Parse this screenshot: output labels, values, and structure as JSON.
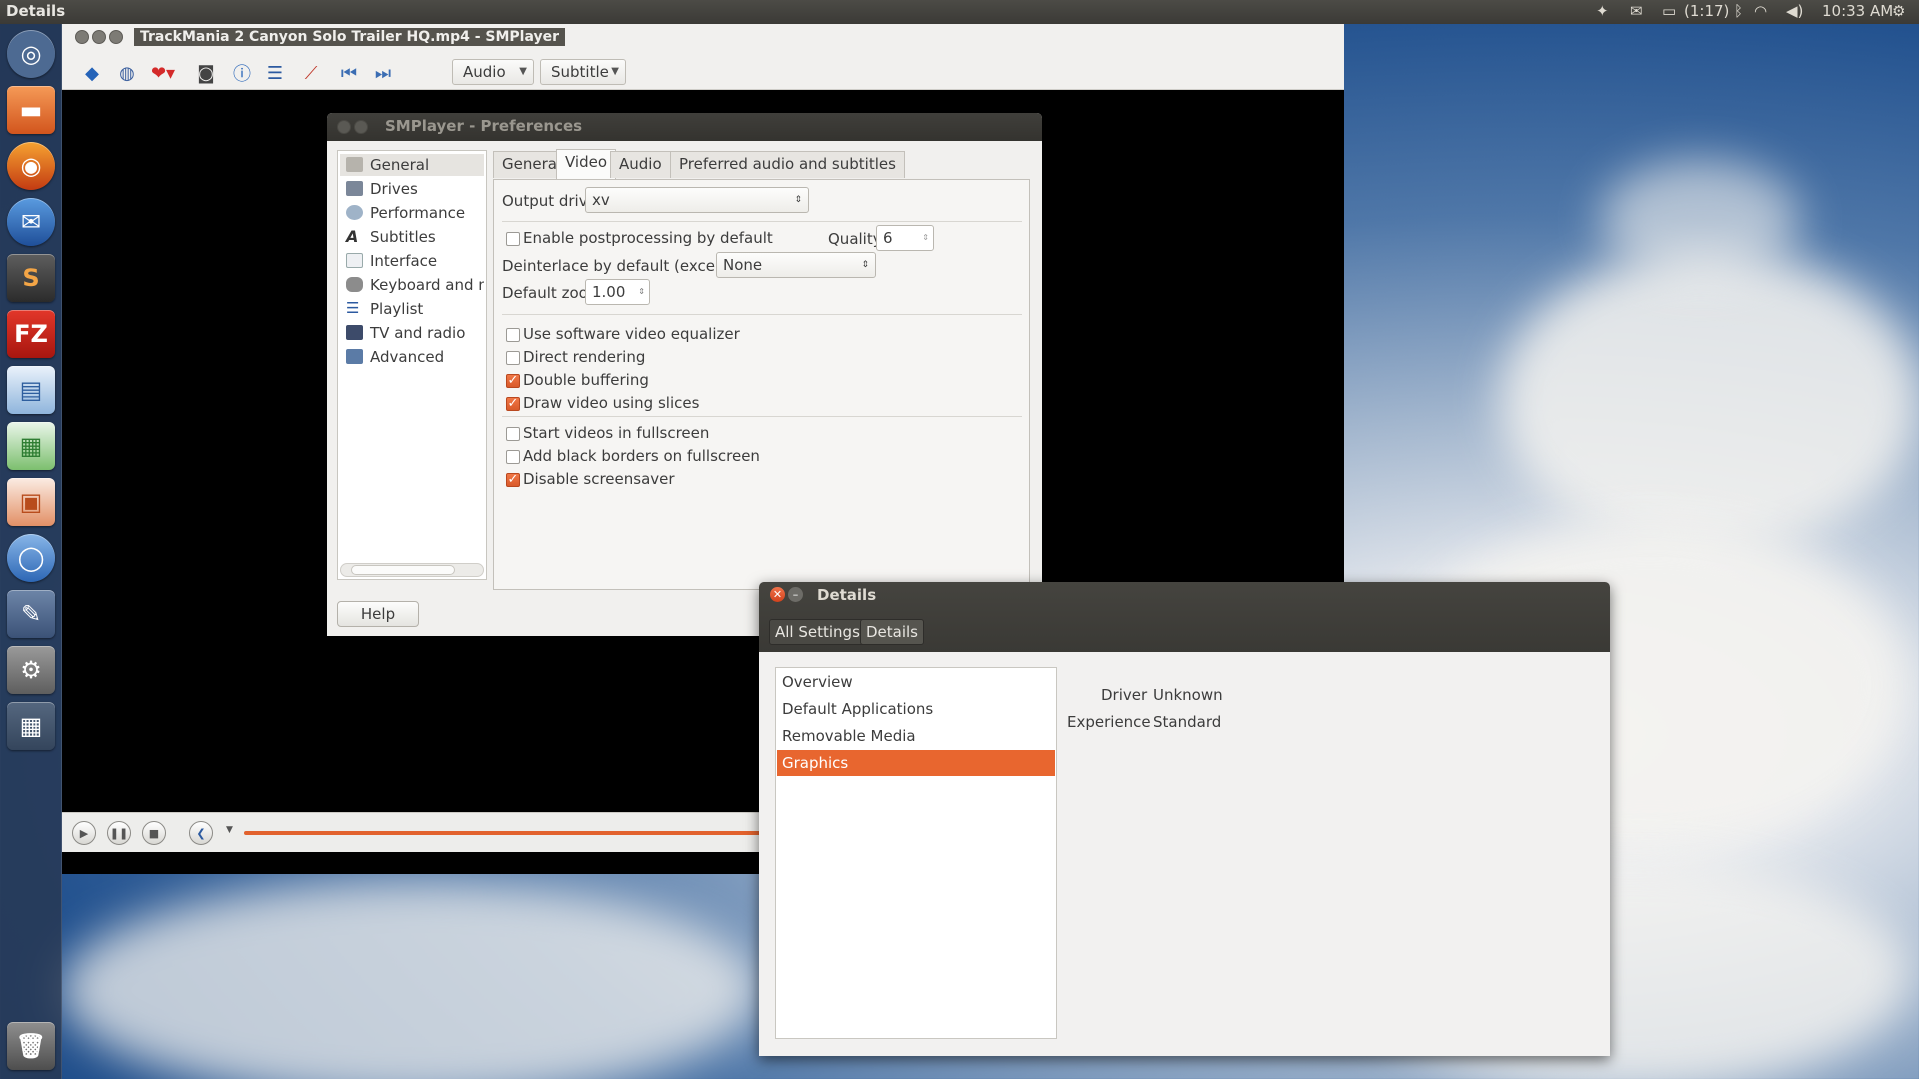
{
  "top_panel": {
    "app_title": "Details",
    "battery": "(1:17)",
    "clock": "10:33 AM"
  },
  "launcher": {
    "items": [
      "Dash home",
      "Files",
      "Firefox",
      "Thunderbird",
      "Sublime Text",
      "FileZilla",
      "Writer",
      "Calc",
      "Impress",
      "Chromium",
      "System Tools",
      "System Settings",
      "Workspace Switcher",
      "Trash"
    ]
  },
  "smplayer": {
    "window_title": "TrackMania 2 Canyon Solo Trailer HQ.mp4 - SMPlayer",
    "toolbar": {
      "audio_label": "Audio",
      "subtitle_label": "Subtitle"
    }
  },
  "prefs": {
    "title": "SMPlayer - Preferences",
    "sections": [
      "General",
      "Drives",
      "Performance",
      "Subtitles",
      "Interface",
      "Keyboard and mo",
      "Playlist",
      "TV and radio",
      "Advanced"
    ],
    "selected_section": "General",
    "tabs": [
      "General",
      "Video",
      "Audio",
      "Preferred audio and subtitles"
    ],
    "active_tab": "Video",
    "output_driver_label": "Output driver:",
    "output_driver_value": "xv",
    "postprocessing_label": "Enable postprocessing by default",
    "postprocessing_checked": false,
    "quality_label": "Quality:",
    "quality_value": "6",
    "deinterlace_label": "Deinterlace by default (except for TV):",
    "deinterlace_value": "None",
    "zoom_label": "Default zoom:",
    "zoom_value": "1.00",
    "options": [
      {
        "label": "Use software video equalizer",
        "checked": false
      },
      {
        "label": "Direct rendering",
        "checked": false
      },
      {
        "label": "Double buffering",
        "checked": true
      },
      {
        "label": "Draw video using slices",
        "checked": true
      },
      {
        "label": "Start videos in fullscreen",
        "checked": false
      },
      {
        "label": "Add black borders on fullscreen",
        "checked": false
      },
      {
        "label": "Disable screensaver",
        "checked": true
      }
    ],
    "help_label": "Help"
  },
  "details": {
    "title": "Details",
    "breadcrumb": [
      "All Settings",
      "Details"
    ],
    "items": [
      "Overview",
      "Default Applications",
      "Removable Media",
      "Graphics"
    ],
    "selected": "Graphics",
    "driver_label": "Driver",
    "driver_value": "Unknown",
    "experience_label": "Experience",
    "experience_value": "Standard"
  },
  "colors": {
    "accent": "#e8662f",
    "panel": "#3c3b37",
    "checked": "#e2622d"
  }
}
